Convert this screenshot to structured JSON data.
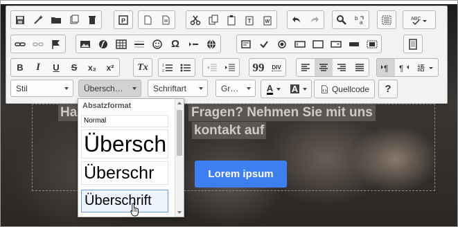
{
  "hero": {
    "line1a": "Ha",
    "line1b": "Fragen? Nehmen Sie mit uns",
    "line2": "kontakt auf",
    "button": "Lorem ipsum"
  },
  "toolbar": {
    "row1": [
      "save-icon",
      "magic-wand-icon",
      "folder-icon",
      "copy-template-icon",
      "trash-icon",
      "preview-icon",
      "new-page-icon",
      "document-icon",
      "cut-icon",
      "copy-icon",
      "paste-icon",
      "paste-text-icon",
      "paste-word-icon",
      "undo-icon",
      "redo-icon",
      "find-icon",
      "replace-icon",
      "select-all-icon",
      "spellcheck-icon"
    ],
    "row2": [
      "link-icon",
      "unlink-icon",
      "anchor-flag-icon",
      "image-icon",
      "flash-icon",
      "table-icon",
      "horizontal-rule-icon",
      "smiley-icon",
      "omega-icon",
      "page-break-icon",
      "iframe-icon",
      "form-icon",
      "checkbox-icon",
      "radio-icon",
      "textfield-icon",
      "select-icon",
      "button-icon",
      "image-button-icon",
      "hidden-field-icon"
    ],
    "row3": {
      "bold": "B",
      "italic": "I",
      "underline": "U",
      "strike": "S",
      "subscript": "x₂",
      "superscript": "x²",
      "remove_format": "Tx",
      "blockquote": "99",
      "div": "DIV"
    },
    "row4": {
      "style": "Stil",
      "format": "Übersch…",
      "font": "Schriftart",
      "size": "Gr…",
      "text_color": "A",
      "bg_color": "A",
      "source": "Quellcode",
      "help": "?"
    }
  },
  "dropdown": {
    "title": "Absatzformat",
    "items": [
      "Normal",
      "Übersch",
      "Überschr",
      "Überschrift"
    ]
  },
  "colors": {
    "accent": "#3d7ef0",
    "toolbar_bg": "#f2f2f2"
  }
}
